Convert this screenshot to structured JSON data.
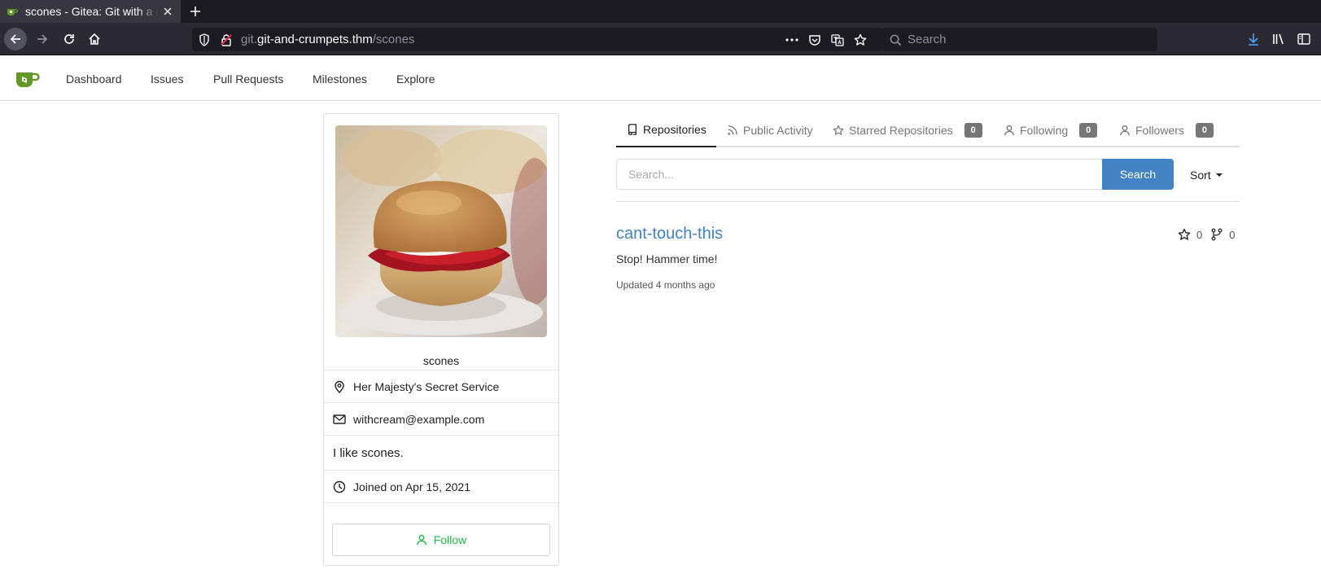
{
  "browser": {
    "tab_title": "scones - Gitea: Git with a cup of tea",
    "url_host_prefix": "git.",
    "url_host": "git-and-crumpets.thm",
    "url_path": "/scones",
    "search_placeholder": "Search"
  },
  "nav": {
    "items": [
      "Dashboard",
      "Issues",
      "Pull Requests",
      "Milestones",
      "Explore"
    ]
  },
  "profile": {
    "username": "scones",
    "location": "Her Majesty's Secret Service",
    "email": "withcream@example.com",
    "bio": "I like scones.",
    "joined": "Joined on Apr 15, 2021",
    "follow_label": "Follow",
    "colors": {
      "follow": "#21ba45"
    }
  },
  "tabs": [
    {
      "label": "Repositories",
      "icon": "repo-icon",
      "active": true
    },
    {
      "label": "Public Activity",
      "icon": "rss-icon"
    },
    {
      "label": "Starred Repositories",
      "icon": "star-icon",
      "count": "0"
    },
    {
      "label": "Following",
      "icon": "person-icon",
      "count": "0"
    },
    {
      "label": "Followers",
      "icon": "person-icon",
      "count": "0"
    }
  ],
  "repo_search": {
    "placeholder": "Search...",
    "button": "Search",
    "sort": "Sort"
  },
  "repos": [
    {
      "name": "cant-touch-this",
      "description": "Stop! Hammer time!",
      "updated": "Updated 4 months ago",
      "stars": "0",
      "forks": "0"
    }
  ],
  "colors": {
    "link": "#4183c4",
    "primary_button": "#4183c4",
    "gitea_green": "#609926"
  }
}
